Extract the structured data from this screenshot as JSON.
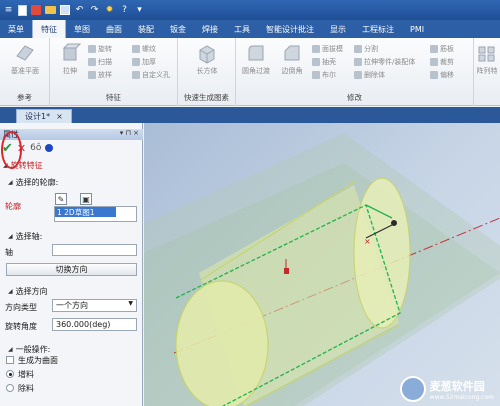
{
  "menu": {
    "items": [
      "菜单",
      "特征",
      "草图",
      "曲面",
      "装配",
      "钣金",
      "焊接",
      "工具",
      "智能设计批注",
      "显示",
      "工程标注",
      "PMI"
    ],
    "active_index": 1
  },
  "ribbon": {
    "groups": {
      "reference": {
        "title": "参考",
        "btn": "基准平面"
      },
      "features": {
        "title": "特征",
        "pull": "拉伸",
        "small": [
          "旋转",
          "扫描",
          "放样",
          "螺纹",
          "加厚",
          "自定义孔"
        ]
      },
      "quick": {
        "title": "快速生成图素",
        "btn": "长方体"
      },
      "modify": {
        "title": "修改",
        "round": "圆角过渡",
        "chamfer": "边倒角",
        "small": [
          "面拔模",
          "抽壳",
          "布尔",
          "分割",
          "拉伸零件/装配体",
          "删除体",
          "筋板",
          "裁剪",
          "偏移"
        ]
      },
      "pattern": {
        "label": "阵列特"
      }
    }
  },
  "doc_tab": {
    "label": "设计1*",
    "close": "×"
  },
  "panel": {
    "title": "属性",
    "pin": "▾ ⊓ ×",
    "feature_title": "旋转特征",
    "profile_section": "选择的轮廓:",
    "profile_label": "轮廓",
    "profile_item": "1   2D草图1",
    "axis_section": "选择轴:",
    "axis_label": "轴",
    "axis_value": "",
    "switch_direction": "切换方向",
    "dir_section": "选择方向",
    "dir_type_label": "方向类型",
    "dir_type_value": "一个方向",
    "angle_label": "旋转角度",
    "angle_value": "360.000(deg)",
    "general_section": "一般操作:",
    "gen_surface": "生成为曲面",
    "add_material": "增料",
    "remove_material": "除料"
  },
  "watermark": {
    "name": "麦葱软件园",
    "url": "www.52maicong.com"
  }
}
